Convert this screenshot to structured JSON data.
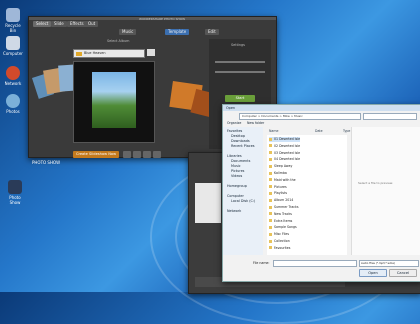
{
  "main_window": {
    "title": "WONDERSHARE PHOTO SHOW",
    "tabs": [
      "Select",
      "Slide",
      "Effects",
      "Out",
      "Music",
      "Template",
      "Edit"
    ],
    "album_label": "Select Album",
    "album_select": "Blue Heaven",
    "side_label": "Settings",
    "start_button": "Start",
    "stop_button": "Stop",
    "convert_button": "Create Slideshow Now",
    "footer": "PHOTO SHOW"
  },
  "explorer": {
    "title": "Open",
    "address": "Computer > Documents > Mike > Music",
    "toolbar_organize": "Organize",
    "toolbar_new_folder": "New folder",
    "col_name": "Name",
    "col_date": "Date",
    "col_type": "Type",
    "nav": [
      "Favorites",
      "Desktop",
      "Downloads",
      "Recent Places",
      "Libraries",
      "Documents",
      "Music",
      "Pictures",
      "Videos",
      "Homegroup",
      "Computer",
      "Local Disk (C:)",
      "Network"
    ],
    "files": [
      "01 Deserted Isle",
      "02 Deserted Isle",
      "03 Deserted Isle",
      "04 Deserted Isle",
      "Sleep Away",
      "Kalimba",
      "Maid with the",
      "Pictures",
      "Playlists",
      "Album 2014",
      "Summer Tracks",
      "New Tracks",
      "Extra Items",
      "Sample Songs",
      "Misc Files",
      "Collection",
      "Favourites"
    ],
    "preview_note": "Select a file to preview.",
    "filename_label": "File name:",
    "filetype_value": "Audio Files (*.mp3;*.wma)",
    "open_button": "Open",
    "cancel_button": "Cancel"
  },
  "desktop_icons": [
    "Recycle Bin",
    "Computer",
    "Network",
    "Photos",
    "Photo Show"
  ],
  "colors": {
    "explorer_select": "#cfe3f8",
    "dark_panel": "#3a3a3a",
    "accent_green": "#6a9f3a",
    "accent_orange": "#c47a1d"
  }
}
